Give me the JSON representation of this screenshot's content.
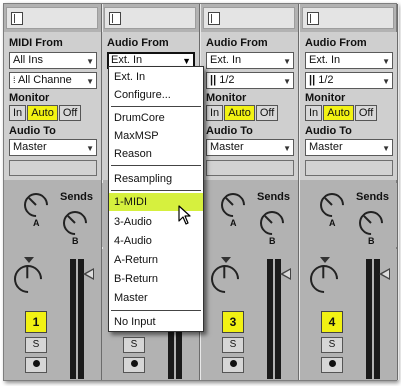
{
  "tracks": [
    {
      "input_label": "MIDI From",
      "input_value": "All Ins",
      "channel_value": "All Channe",
      "monitor_label": "Monitor",
      "monitor_options": [
        "In",
        "Auto",
        "Off"
      ],
      "monitor_active": "Auto",
      "output_label": "Audio To",
      "output_value": "Master",
      "sends_label": "Sends",
      "send_a": "A",
      "send_b": "B",
      "number": "1",
      "solo": "S",
      "arm": "record-arm-icon"
    },
    {
      "input_label": "Audio From",
      "input_value": "Ext. In",
      "number": "2",
      "solo": "S",
      "arm": "record-arm-icon"
    },
    {
      "input_label": "Audio From",
      "input_value": "Ext. In",
      "channel_value": "1/2",
      "monitor_label": "Monitor",
      "monitor_options": [
        "In",
        "Auto",
        "Off"
      ],
      "monitor_active": "Auto",
      "output_label": "Audio To",
      "output_value": "Master",
      "sends_label": "Sends",
      "send_a": "A",
      "send_b": "B",
      "number": "3",
      "solo": "S",
      "arm": "record-arm-icon"
    },
    {
      "input_label": "Audio From",
      "input_value": "Ext. In",
      "channel_value": "1/2",
      "monitor_label": "Monitor",
      "monitor_options": [
        "In",
        "Auto",
        "Off"
      ],
      "monitor_active": "Auto",
      "output_label": "Audio To",
      "output_value": "Master",
      "sends_label": "Sends",
      "send_a": "A",
      "send_b": "B",
      "number": "4",
      "solo": "S",
      "arm": "record-arm-icon"
    }
  ],
  "dropdown_menu": {
    "items": [
      "Ext. In",
      "Configure...",
      "DrumCore",
      "MaxMSP",
      "Reason",
      "Resampling",
      "1-MIDI",
      "3-Audio",
      "4-Audio",
      "A-Return",
      "B-Return",
      "Master",
      "No Input"
    ],
    "highlighted": "1-MIDI"
  },
  "colors": {
    "track_active": "#f2f213",
    "monitor_active": "#f2f213",
    "menu_highlight": "#d6f03e",
    "panel": "#b2b2b2",
    "io_section": "#cfcfcf"
  }
}
